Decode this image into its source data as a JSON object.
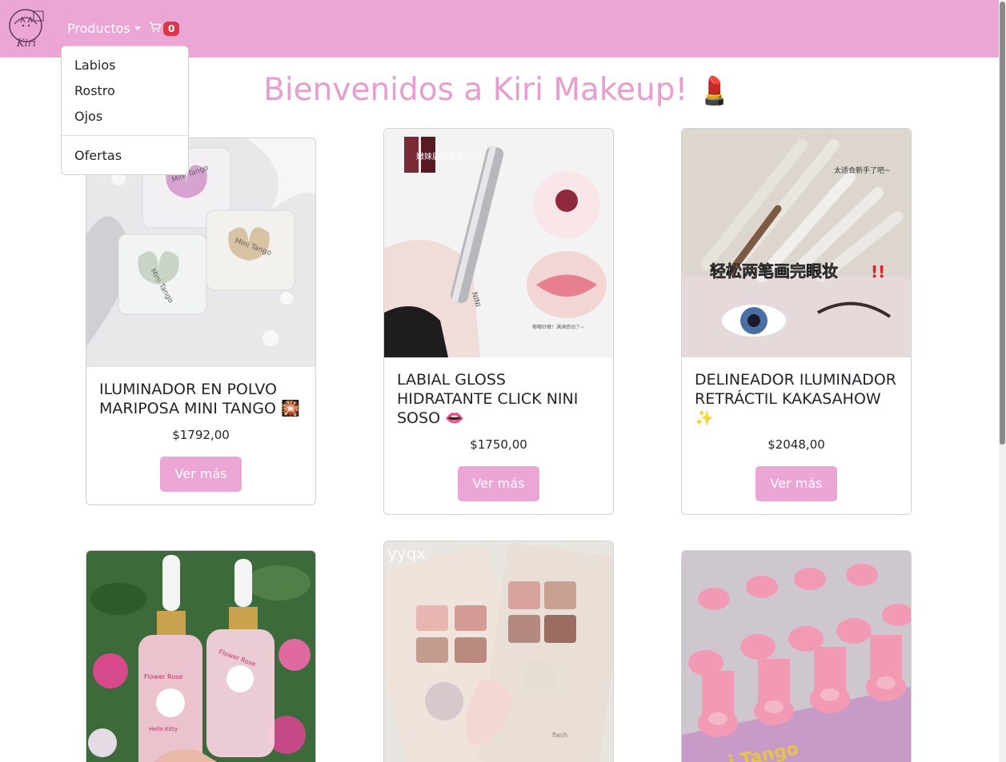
{
  "navbar": {
    "logo_text": "Kiri",
    "products_label": "Productos",
    "cart_count": "0"
  },
  "dropdown": {
    "items": [
      "Labios",
      "Rostro",
      "Ojos"
    ],
    "offers_label": "Ofertas"
  },
  "page": {
    "title": "Bienvenidos a Kiri Makeup!",
    "title_emoji": "💄"
  },
  "products": [
    {
      "title": "ILUMINADOR EN POLVO MARIPOSA MINI TANGO 🎇",
      "price": "$1792,00",
      "button": "Ver más",
      "image_subject": "butterfly-highlighter-photo",
      "image_text": [
        "Mini Tango",
        "Mini Tango",
        "Mini Tango"
      ]
    },
    {
      "title": "LABIAL GLOSS HIDRATANTE CLICK NINI SOSO 👄",
      "price": "$1750,00",
      "button": "Ver más",
      "image_subject": "lip-gloss-photo",
      "image_text": [
        "嫩妹届的君王！！",
        "NINI",
        "嘟嘟好嫩！满满感动了~"
      ]
    },
    {
      "title": "DELINEADOR ILUMINADOR RETRÁCTIL KAKASAHOW ✨",
      "price": "$2048,00",
      "button": "Ver más",
      "image_subject": "eyeliner-pencils-photo",
      "image_text": [
        "太适合新手了吧~",
        "轻松两笔画完眼妆",
        "!!"
      ]
    },
    {
      "image_subject": "hello-kitty-serum-bottles-photo",
      "image_text": [
        "Flower Rose",
        "Flower Rose",
        "Hello Kitty"
      ]
    },
    {
      "image_subject": "eyeshadow-palettes-photo",
      "image_text": [
        "yyqx",
        "flash"
      ]
    },
    {
      "image_subject": "pink-giraffe-lipsticks-photo",
      "image_text": [
        "i Tango"
      ]
    }
  ],
  "colors": {
    "brand_pink": "#eba6d5",
    "title_pink": "#e59ecd",
    "badge_red": "#dc3545"
  }
}
